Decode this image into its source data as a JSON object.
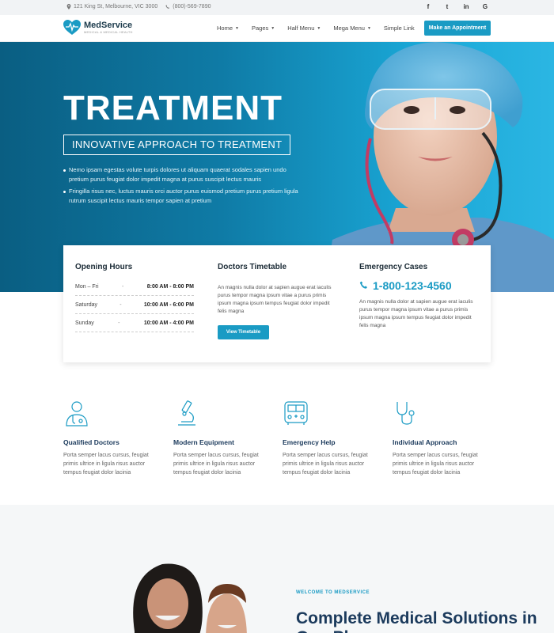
{
  "topbar": {
    "address": "121 King St, Melbourne, VIC 3000",
    "phone": "(800)-569-7890",
    "social": [
      "f",
      "t",
      "in",
      "G"
    ]
  },
  "header": {
    "brand": "MedService",
    "tagline": "MEDICAL & MEDICAL HEALTH",
    "nav": [
      "Home",
      "Pages",
      "Half Menu",
      "Mega Menu",
      "Simple Link"
    ],
    "cta": "Make an Appointment"
  },
  "hero": {
    "title": "TREATMENT",
    "subtitle": "INNOVATIVE APPROACH TO TREATMENT",
    "bullets": [
      "Nemo ipsam egestas volute turpis dolores ut aliquam quaerat sodales sapien undo pretium purus feugiat dolor impedit magna at purus suscipit lectus mauris",
      "Fringilla risus nec, luctus mauris orci auctor purus euismod pretium purus pretium ligula rutrum suscipit lectus mauris tempor sapien at pretium"
    ]
  },
  "opening": {
    "title": "Opening Hours",
    "rows": [
      {
        "day": "Mon – Fri",
        "time": "8:00 AM - 8:00 PM"
      },
      {
        "day": "Saturday",
        "time": "10:00 AM - 6:00 PM"
      },
      {
        "day": "Sunday",
        "time": "10:00 AM - 4:00 PM"
      }
    ]
  },
  "timetable": {
    "title": "Doctors Timetable",
    "text": "An magnis nulla dolor at sapien augue erat iaculis purus tempor magna ipsum vitae a purus primis ipsum magna ipsum tempus feugiat dolor impedit felis magna",
    "button": "View Timetable"
  },
  "emergency": {
    "title": "Emergency Cases",
    "phone": "1-800-123-4560",
    "text": "An magnis nulla dolor at sapien augue erat iaculis purus tempor magna ipsum vitae a purus primis ipsum magna ipsum tempus feugiat dolor impedit felis magna"
  },
  "features": [
    {
      "icon": "doctor-icon",
      "title": "Qualified Doctors",
      "text": "Porta semper lacus cursus, feugiat primis ultrice in ligula risus auctor tempus feugiat dolor lacinia"
    },
    {
      "icon": "microscope-icon",
      "title": "Modern Equipment",
      "text": "Porta semper lacus cursus, feugiat primis ultrice in ligula risus auctor tempus feugiat dolor lacinia"
    },
    {
      "icon": "ambulance-icon",
      "title": "Emergency Help",
      "text": "Porta semper lacus cursus, feugiat primis ultrice in ligula risus auctor tempus feugiat dolor lacinia"
    },
    {
      "icon": "stethoscope-icon",
      "title": "Individual Approach",
      "text": "Porta semper lacus cursus, feugiat primis ultrice in ligula risus auctor tempus feugiat dolor lacinia"
    }
  ],
  "about": {
    "kicker": "WELCOME TO MEDSERVICE",
    "heading": "Complete Medical Solutions in One Place"
  },
  "colors": {
    "accent": "#1a9bc4",
    "navy": "#1b3a5c",
    "hero_dark": "#0a5e82"
  }
}
